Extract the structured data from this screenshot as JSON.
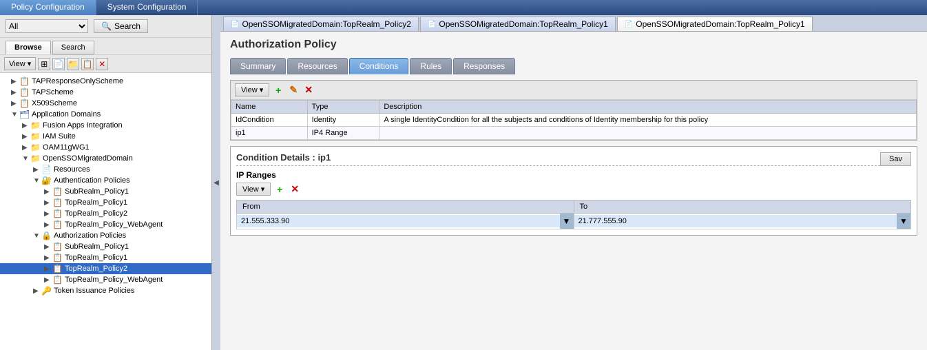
{
  "topNav": {
    "items": [
      {
        "id": "policy-config",
        "label": "Policy Configuration",
        "active": true
      },
      {
        "id": "system-config",
        "label": "System Configuration",
        "active": false
      }
    ]
  },
  "leftPanel": {
    "dropdown": {
      "value": "All",
      "options": [
        "All"
      ]
    },
    "searchBtn": "Search",
    "tabs": [
      {
        "id": "browse",
        "label": "Browse",
        "active": true
      },
      {
        "id": "search",
        "label": "Search",
        "active": false
      }
    ],
    "toolbar": {
      "viewBtn": "View",
      "icons": [
        "⊞",
        "📄",
        "📁",
        "📋",
        "✕"
      ]
    },
    "tree": [
      {
        "level": 0,
        "expanded": true,
        "label": "TAPResponseOnlyScheme",
        "type": "policy"
      },
      {
        "level": 0,
        "expanded": false,
        "label": "TAPScheme",
        "type": "policy"
      },
      {
        "level": 0,
        "expanded": false,
        "label": "X509Scheme",
        "type": "policy"
      },
      {
        "level": 0,
        "expanded": true,
        "label": "Application Domains",
        "type": "domain"
      },
      {
        "level": 1,
        "expanded": true,
        "label": "Fusion Apps Integration",
        "type": "folder"
      },
      {
        "level": 1,
        "expanded": false,
        "label": "IAM Suite",
        "type": "folder"
      },
      {
        "level": 1,
        "expanded": false,
        "label": "OAM11gWG1",
        "type": "folder"
      },
      {
        "level": 1,
        "expanded": true,
        "label": "OpenSSOMigratedDomain",
        "type": "folder"
      },
      {
        "level": 2,
        "expanded": false,
        "label": "Resources",
        "type": "folder"
      },
      {
        "level": 2,
        "expanded": true,
        "label": "Authentication Policies",
        "type": "folder"
      },
      {
        "level": 3,
        "expanded": false,
        "label": "SubRealm_Policy1",
        "type": "policy"
      },
      {
        "level": 3,
        "expanded": false,
        "label": "TopRealm_Policy1",
        "type": "policy"
      },
      {
        "level": 3,
        "expanded": false,
        "label": "TopRealm_Policy2",
        "type": "policy"
      },
      {
        "level": 3,
        "expanded": false,
        "label": "TopRealm_Policy_WebAgent",
        "type": "policy"
      },
      {
        "level": 2,
        "expanded": true,
        "label": "Authorization Policies",
        "type": "folder"
      },
      {
        "level": 3,
        "expanded": false,
        "label": "SubRealm_Policy1",
        "type": "policy"
      },
      {
        "level": 3,
        "expanded": false,
        "label": "TopRealm_Policy1",
        "type": "policy"
      },
      {
        "level": 3,
        "expanded": false,
        "label": "TopRealm_Policy2",
        "type": "policy",
        "selected": true
      },
      {
        "level": 3,
        "expanded": false,
        "label": "TopRealm_Policy_WebAgent",
        "type": "policy"
      },
      {
        "level": 2,
        "expanded": false,
        "label": "Token Issuance Policies",
        "type": "folder"
      }
    ]
  },
  "rightPanel": {
    "docTabs": [
      {
        "id": "tab1",
        "label": "OpenSSOMigratedDomain:TopRealm_Policy2",
        "active": false
      },
      {
        "id": "tab2",
        "label": "OpenSSOMigratedDomain:TopRealm_Policy1",
        "active": false
      },
      {
        "id": "tab3",
        "label": "OpenSSOMigratedDomain:TopRealm_Policy1",
        "active": true
      }
    ],
    "pageTitle": "Authorization Policy",
    "subTabs": [
      {
        "id": "summary",
        "label": "Summary",
        "active": false
      },
      {
        "id": "resources",
        "label": "Resources",
        "active": false
      },
      {
        "id": "conditions",
        "label": "Conditions",
        "active": true
      },
      {
        "id": "rules",
        "label": "Rules",
        "active": false
      },
      {
        "id": "responses",
        "label": "Responses",
        "active": false
      }
    ],
    "conditionsTable": {
      "toolbar": {
        "viewBtn": "View",
        "addIcon": "+",
        "editIcon": "✎",
        "deleteIcon": "✕"
      },
      "columns": [
        "Name",
        "Type",
        "Description"
      ],
      "rows": [
        {
          "name": "IdCondition",
          "type": "Identity",
          "description": "A single IdentityCondition for all the subjects and conditions of Identity membership for this policy"
        },
        {
          "name": "ip1",
          "type": "IP4 Range",
          "description": ""
        }
      ]
    },
    "conditionDetails": {
      "title": "Condition Details : ip1",
      "saveBtn": "Sav",
      "ipRangesLabel": "IP Ranges",
      "toolbar": {
        "viewBtn": "View",
        "addIcon": "+",
        "deleteIcon": "✕"
      },
      "columns": [
        "From",
        "To"
      ],
      "rows": [
        {
          "from": "21.555.333.90",
          "to": "21.777.555.90"
        }
      ]
    }
  }
}
